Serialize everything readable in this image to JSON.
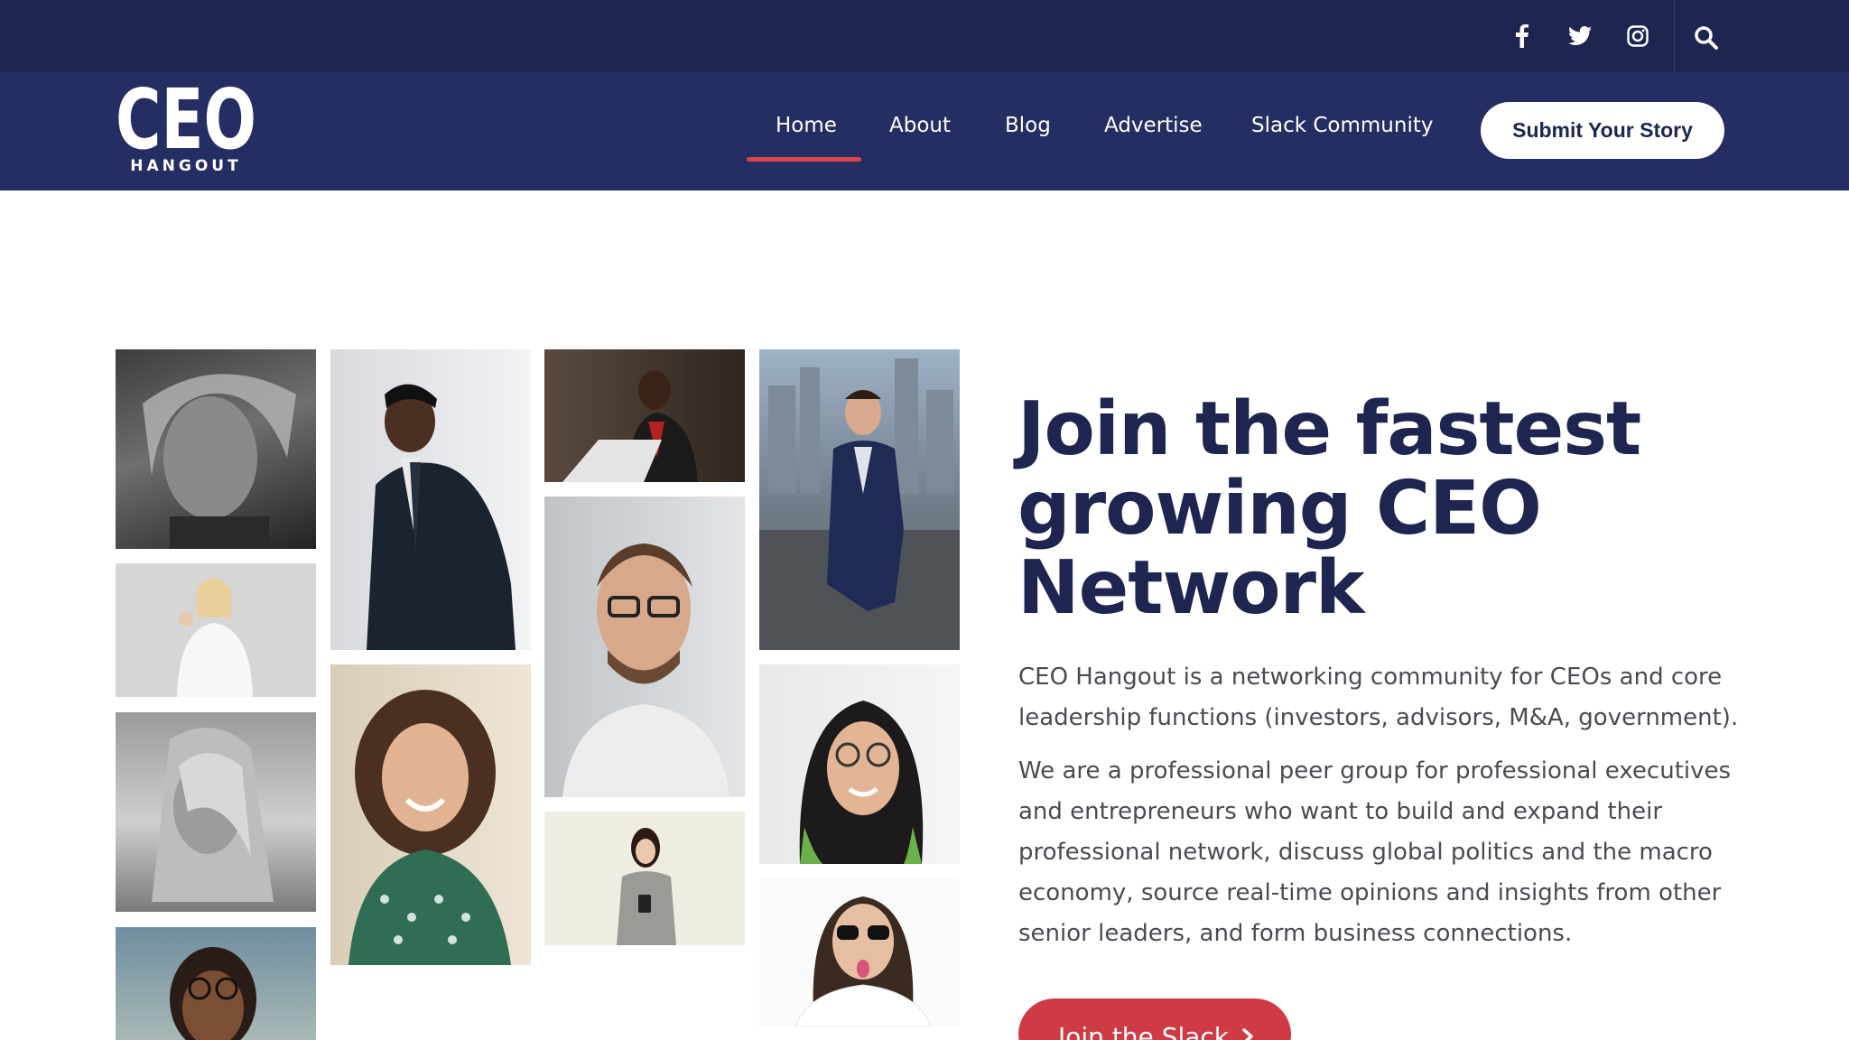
{
  "topbar": {
    "icons": [
      "facebook-icon",
      "twitter-icon",
      "instagram-icon",
      "search-icon"
    ]
  },
  "logo": {
    "brand_letters": "CEO",
    "subtitle": "HANGOUT"
  },
  "nav": {
    "items": [
      {
        "label": "Home",
        "active": true
      },
      {
        "label": "About"
      },
      {
        "label": "Blog"
      },
      {
        "label": "Advertise"
      },
      {
        "label": "Slack Community"
      }
    ],
    "cta_label": "Submit Your Story"
  },
  "hero": {
    "headline_line1": "Join the fastest",
    "headline_line2": "growing CEO",
    "headline_line3": "Network",
    "paragraph1": "CEO Hangout is a networking community for CEOs and core leadership functions (investors, advisors, M&A, government).",
    "paragraph2": "We are a professional peer group for professional executives and entrepreneurs who want to build and expand their professional network, discuss global politics and the macro economy, source real-time opinions and insights from other senior leaders, and form business connections.",
    "cta_label": "Join the Slack",
    "cta_icon": "chevron-right-icon"
  },
  "colors": {
    "topbar_bg": "#1e2550",
    "navbar_bg": "#252e62",
    "heading": "#1e2550",
    "accent_red": "#cf3b45",
    "body_text": "#4a4a55"
  },
  "gallery": {
    "photos": [
      "portrait-man-long-hair-bw",
      "woman-white-shirt-waving",
      "woman-blonde-bw",
      "woman-glasses-street",
      "man-suit-adjusting-cuff",
      "woman-curly-hair-smiling",
      "man-laptop-office",
      "man-glasses-smiling",
      "woman-holding-phone",
      "man-suit-rooftop-city",
      "woman-glasses-green-hair",
      "person-sunglasses-tongue"
    ]
  }
}
